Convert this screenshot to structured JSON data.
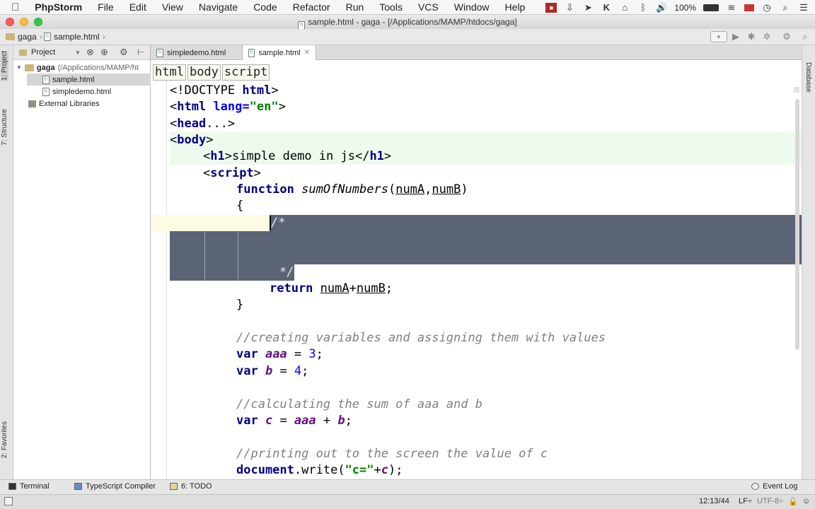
{
  "menubar": {
    "app": "PhpStorm",
    "items": [
      "File",
      "Edit",
      "View",
      "Navigate",
      "Code",
      "Refactor",
      "Run",
      "Tools",
      "VCS",
      "Window",
      "Help"
    ],
    "battery": "100%"
  },
  "window": {
    "title": "sample.html - gaga - [/Applications/MAMP/htdocs/gaga]"
  },
  "navbar": {
    "project": "gaga",
    "file": "sample.html"
  },
  "left_tabs": {
    "project": "1: Project",
    "structure": "7: Structure",
    "favorites": "2: Favorites"
  },
  "right_tabs": {
    "database": "Database"
  },
  "project_panel": {
    "label": "Project",
    "root": "gaga",
    "root_path": "(/Applications/MAMP/ht",
    "files": [
      "sample.html",
      "simpledemo.html"
    ],
    "external": "External Libraries"
  },
  "tabs": [
    {
      "label": "simpledemo.html"
    },
    {
      "label": "sample.html"
    }
  ],
  "editor_breadcrumbs": [
    "html",
    "body",
    "script"
  ],
  "code": {
    "l1": {
      "a": "<!DOCTYPE ",
      "b": "html",
      "c": ">"
    },
    "l2": {
      "a": "<",
      "b": "html ",
      "c": "lang=",
      "d": "\"en\"",
      "e": ">"
    },
    "l3": {
      "a": "<",
      "b": "head",
      "c": "...>"
    },
    "l4": {
      "a": "<",
      "b": "body",
      "c": ">"
    },
    "l5": {
      "a": "<",
      "b": "h1",
      "c": ">simple demo in js</",
      "d": "h1",
      "e": ">"
    },
    "l6": {
      "a": "<",
      "b": "script",
      "c": ">"
    },
    "l7": {
      "a": "function ",
      "b": "sumOfNumbers",
      "c": "(",
      "d": "numA",
      "e": ",",
      "f": "numB",
      "g": ")"
    },
    "l8": "{",
    "l9": "/*",
    "l10": "*/",
    "l11": {
      "a": "return ",
      "b": "numA",
      "c": "+",
      "d": "numB",
      "e": ";"
    },
    "l12": "}",
    "l13": "//creating variables and assigning them with values",
    "l14": {
      "a": "var ",
      "b": "aaa",
      "c": " = ",
      "d": "3",
      "e": ";"
    },
    "l15": {
      "a": "var ",
      "b": "b",
      "c": " = ",
      "d": "4",
      "e": ";"
    },
    "l16": "//calculating the sum of aaa and b",
    "l17": {
      "a": "var ",
      "b": "c",
      "c": " = ",
      "d": "aaa",
      "e": " + ",
      "f": "b",
      "g": ";"
    },
    "l18": "//printing out to the screen the value of c",
    "l19": {
      "a": "document",
      "b": ".write(",
      "c": "\"c=\"",
      "d": "+",
      "e": "c",
      "f": ");"
    }
  },
  "toolwindows": {
    "terminal": "Terminal",
    "ts": "TypeScript Compiler",
    "todo": "6: TODO",
    "eventlog": "Event Log"
  },
  "status": {
    "time": "12:13/44",
    "lf": "LF÷",
    "enc": "UTF-8÷"
  },
  "colors": {
    "selection": "#5a6475",
    "caret_line": "#fffae3",
    "body_line": "#edfaed"
  }
}
